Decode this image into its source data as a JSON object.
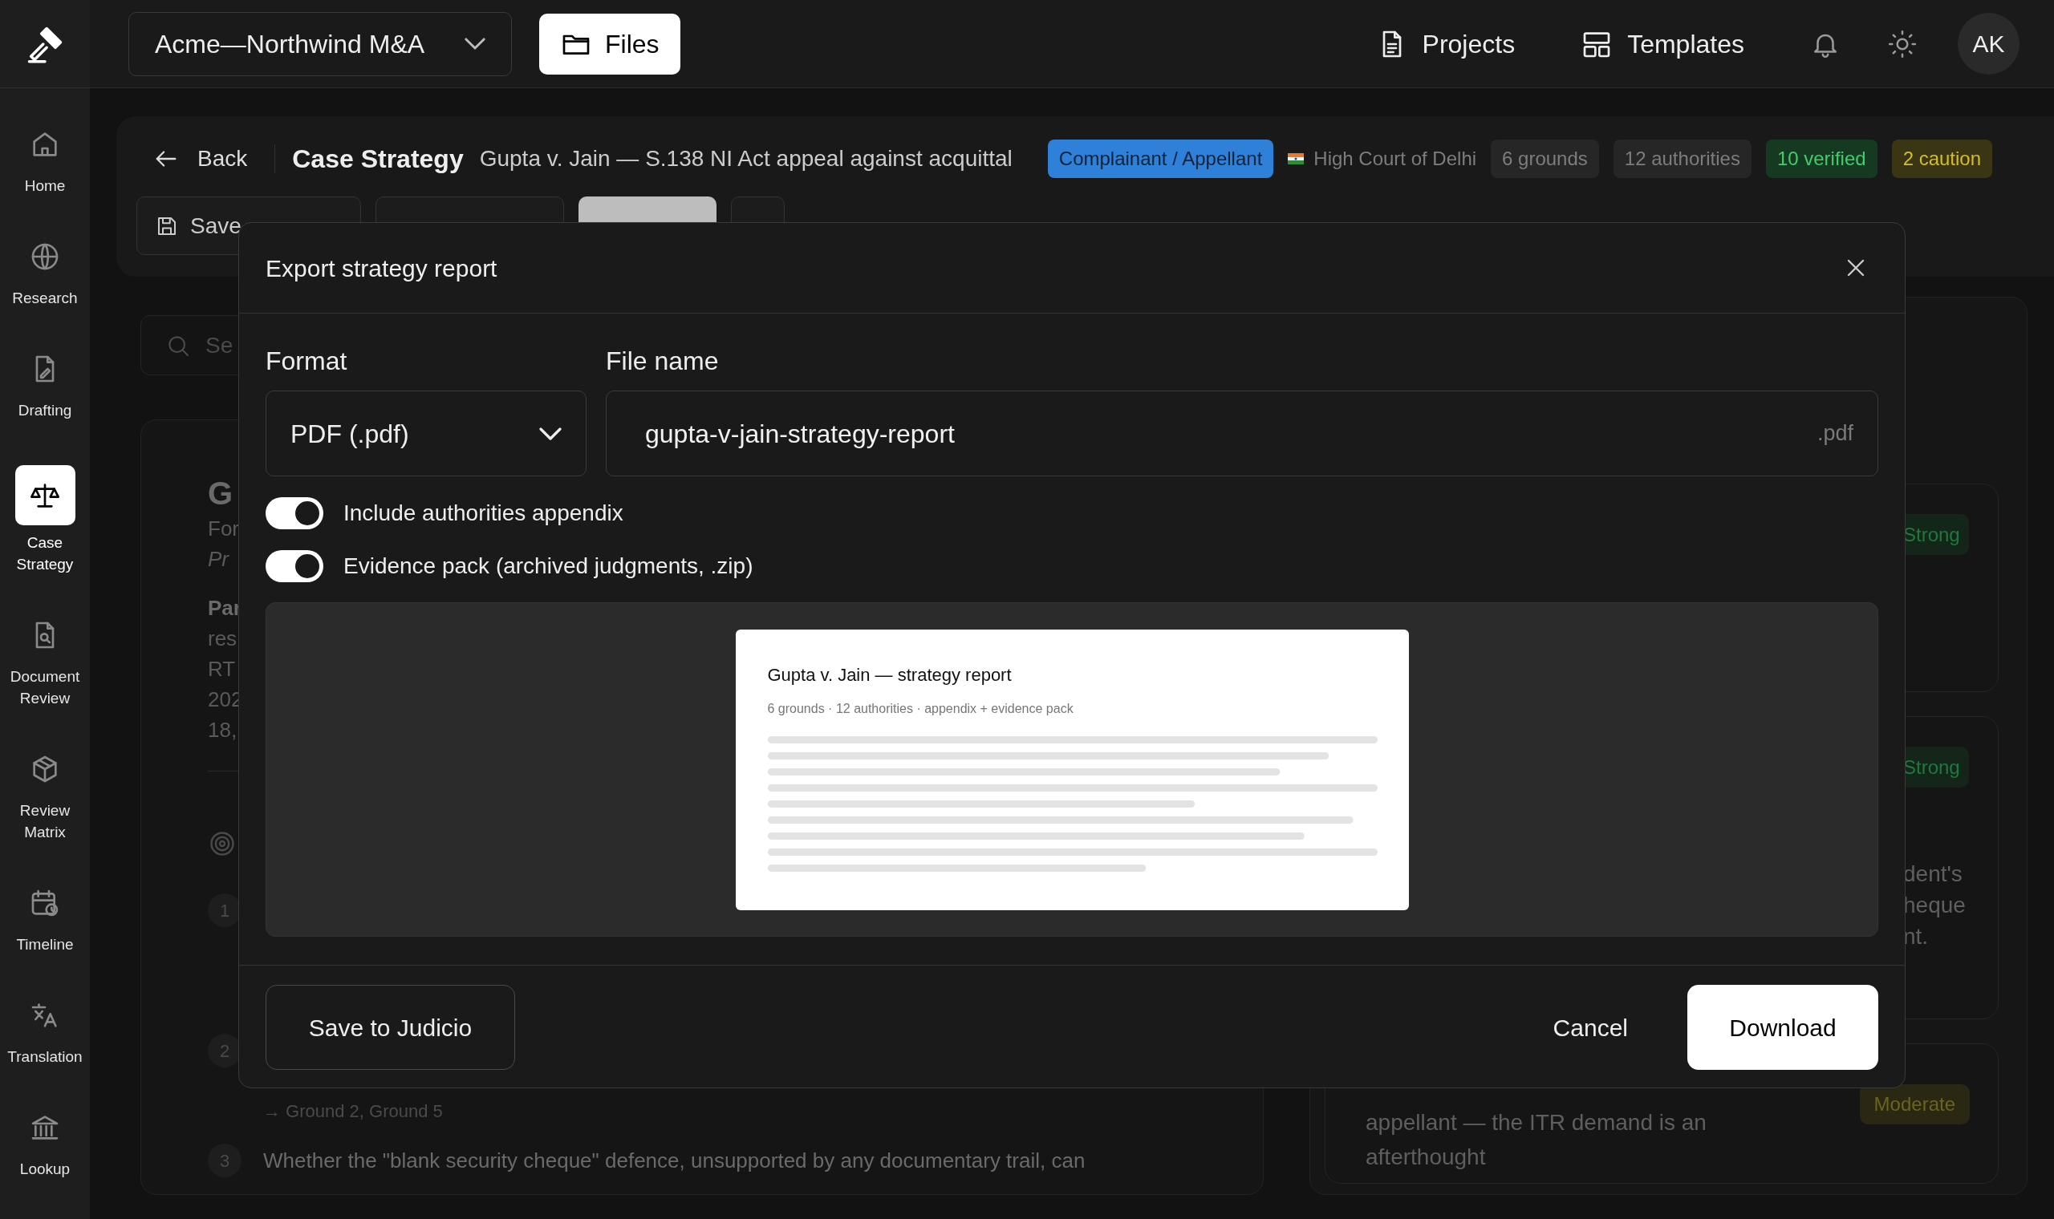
{
  "sidebar": {
    "items": [
      {
        "label": "Home",
        "selected": false
      },
      {
        "label": "Research",
        "selected": false
      },
      {
        "label": "Drafting",
        "selected": false
      },
      {
        "label": "Case Strategy",
        "selected": true
      },
      {
        "label": "Document Review",
        "selected": false
      },
      {
        "label": "Review Matrix",
        "selected": false
      },
      {
        "label": "Timeline",
        "selected": false
      },
      {
        "label": "Translation",
        "selected": false
      },
      {
        "label": "Lookup",
        "selected": false
      }
    ]
  },
  "topbar": {
    "workspace": "Acme—Northwind M&A",
    "files_button": "Files",
    "links": [
      {
        "label": "Projects"
      },
      {
        "label": "Templates"
      }
    ],
    "avatar": "AK"
  },
  "case_header": {
    "back": "Back",
    "title": "Case Strategy",
    "subtitle": "Gupta v. Jain — S.138 NI Act appeal against acquittal",
    "badges": [
      {
        "kind": "role",
        "label": "Complainant / Appellant"
      },
      {
        "kind": "court",
        "label": "High Court of Delhi"
      },
      {
        "kind": "count",
        "label": "6 grounds"
      },
      {
        "kind": "count",
        "label": "12 authorities"
      },
      {
        "kind": "verified",
        "label": "10 verified"
      },
      {
        "kind": "caution",
        "label": "2 caution"
      }
    ],
    "toolbar": {
      "save": "Save"
    }
  },
  "background": {
    "search_placeholder": "Se",
    "left_card": {
      "title": "G",
      "lines": [
        {
          "kind": "plain",
          "text": "For"
        },
        {
          "kind": "italic",
          "text": "Pr"
        },
        {
          "kind": "bold",
          "text": "Par"
        },
        {
          "kind": "plain",
          "text": "res"
        },
        {
          "kind": "plain",
          "text": "RT"
        },
        {
          "kind": "plain",
          "text": "202"
        },
        {
          "kind": "plain",
          "text": "18,"
        }
      ],
      "issues": [
        {
          "number": "1"
        },
        {
          "number": "2",
          "refs": "→ Ground 2, Ground 5"
        },
        {
          "number": "3",
          "text": "Whether the \"blank security cheque\" defence, unsupported by any documentary trail, can"
        }
      ]
    },
    "right_cards": [
      {
        "kind": "strong",
        "rating": "Strong"
      },
      {
        "kind": "strong",
        "rating": "Strong",
        "lines": [
          "dent's",
          "heque",
          "nt."
        ]
      },
      {
        "kind": "moderate",
        "rating": "Moderate",
        "lines": [
          "appellant — the ITR demand is an",
          "afterthought"
        ]
      }
    ]
  },
  "modal": {
    "title": "Export strategy report",
    "format_label": "Format",
    "format_value": "PDF (.pdf)",
    "filename_label": "File name",
    "filename_value": "gupta-v-jain-strategy-report",
    "filename_suffix": ".pdf",
    "options": [
      {
        "label": "Include authorities appendix",
        "on": true
      },
      {
        "label": "Evidence pack (archived judgments, .zip)",
        "on": true
      }
    ],
    "preview": {
      "title": "Gupta v. Jain — strategy report",
      "meta": "6 grounds · 12 authorities · appendix + evidence pack"
    },
    "buttons": {
      "save": "Save to Judicio",
      "cancel": "Cancel",
      "download": "Download"
    }
  }
}
